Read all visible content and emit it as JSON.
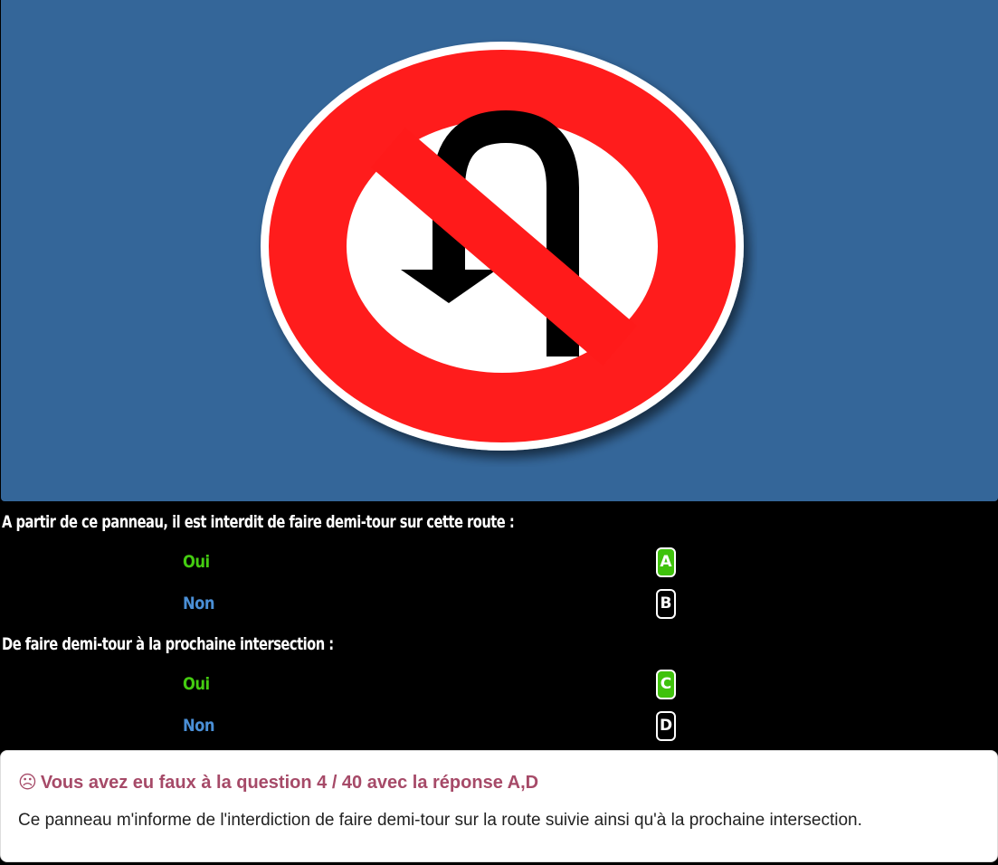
{
  "sign": {
    "description_icon": "no-u-turn-sign-icon",
    "colors": {
      "background": "#346699",
      "ring": "#ff1a1a",
      "inner": "#ffffff",
      "arrow": "#000000"
    }
  },
  "questions": [
    {
      "text": "A partir de ce panneau, il est interdit de faire demi-tour sur cette route :",
      "answers": [
        {
          "label": "Oui",
          "letter": "A",
          "selected": true
        },
        {
          "label": "Non",
          "letter": "B",
          "selected": false
        }
      ]
    },
    {
      "text": "De faire demi-tour à la prochaine intersection :",
      "answers": [
        {
          "label": "Oui",
          "letter": "C",
          "selected": true
        },
        {
          "label": "Non",
          "letter": "D",
          "selected": false
        }
      ]
    }
  ],
  "feedback": {
    "icon": "frown-icon",
    "icon_glyph": "☹",
    "title": "Vous avez eu faux à la question 4 / 40 avec la réponse A,D",
    "text": "Ce panneau m'informe de l'interdiction de faire demi-tour sur la route suivie ainsi qu'à la prochaine intersection.",
    "title_color": "#a64a68"
  }
}
